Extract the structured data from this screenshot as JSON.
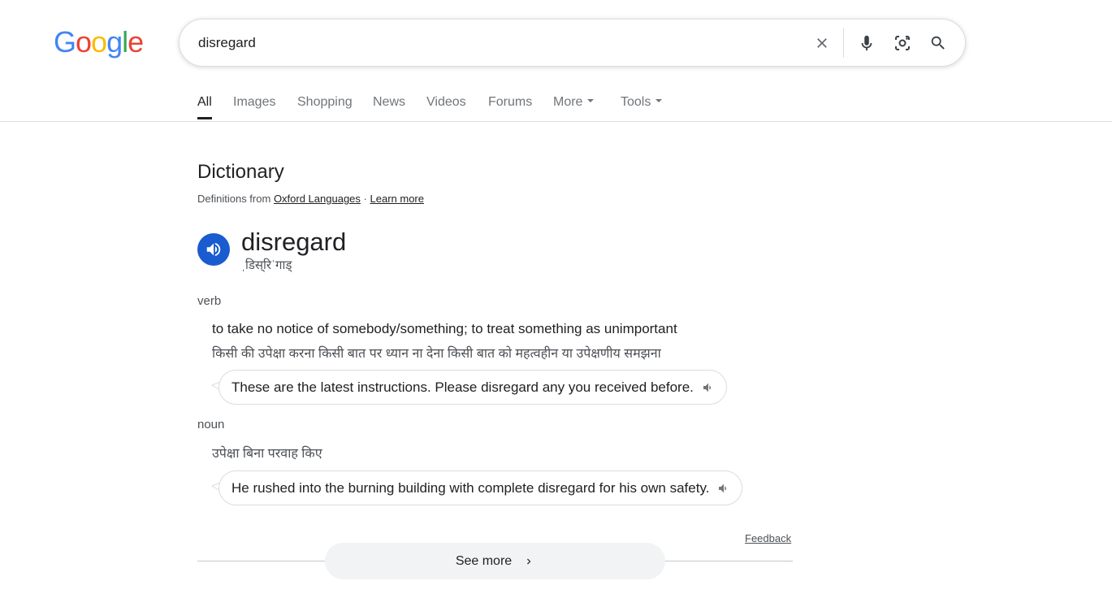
{
  "logo": {
    "letters": [
      "G",
      "o",
      "o",
      "g",
      "l",
      "e"
    ],
    "colors": [
      "#4285F4",
      "#EA4335",
      "#FBBC05",
      "#4285F4",
      "#34A853",
      "#EA4335"
    ]
  },
  "search": {
    "value": "disregard"
  },
  "tabs": [
    {
      "label": "All",
      "active": true
    },
    {
      "label": "Images"
    },
    {
      "label": "Shopping"
    },
    {
      "label": "News"
    },
    {
      "label": "Videos"
    },
    {
      "label": "Forums"
    },
    {
      "label": "More",
      "dropdown": true
    },
    {
      "label": "Tools",
      "dropdown": true
    }
  ],
  "dictionary": {
    "title": "Dictionary",
    "source_prefix": "Definitions from",
    "source_link": "Oxford Languages",
    "separator": "·",
    "learn_more": "Learn more",
    "word": "disregard",
    "phonetic": "ˌडिस्‌रिˈगाड्",
    "accent_color": "#1a5bd0",
    "entries": [
      {
        "pos": "verb",
        "definition": "to take no notice of somebody/something; to treat something as unimportant",
        "translation": "किसी की उपेक्षा करना किसी बात पर ध्यान ना देना किसी बात को महत्वहीन या उपेक्षणीय समझना",
        "example": "These are the latest instructions. Please disregard any you received before."
      },
      {
        "pos": "noun",
        "translation": "उपेक्षा बिना परवाह किए",
        "example": "He rushed into the burning building with complete disregard for his own safety."
      }
    ]
  },
  "feedback": "Feedback",
  "see_more": "See more"
}
